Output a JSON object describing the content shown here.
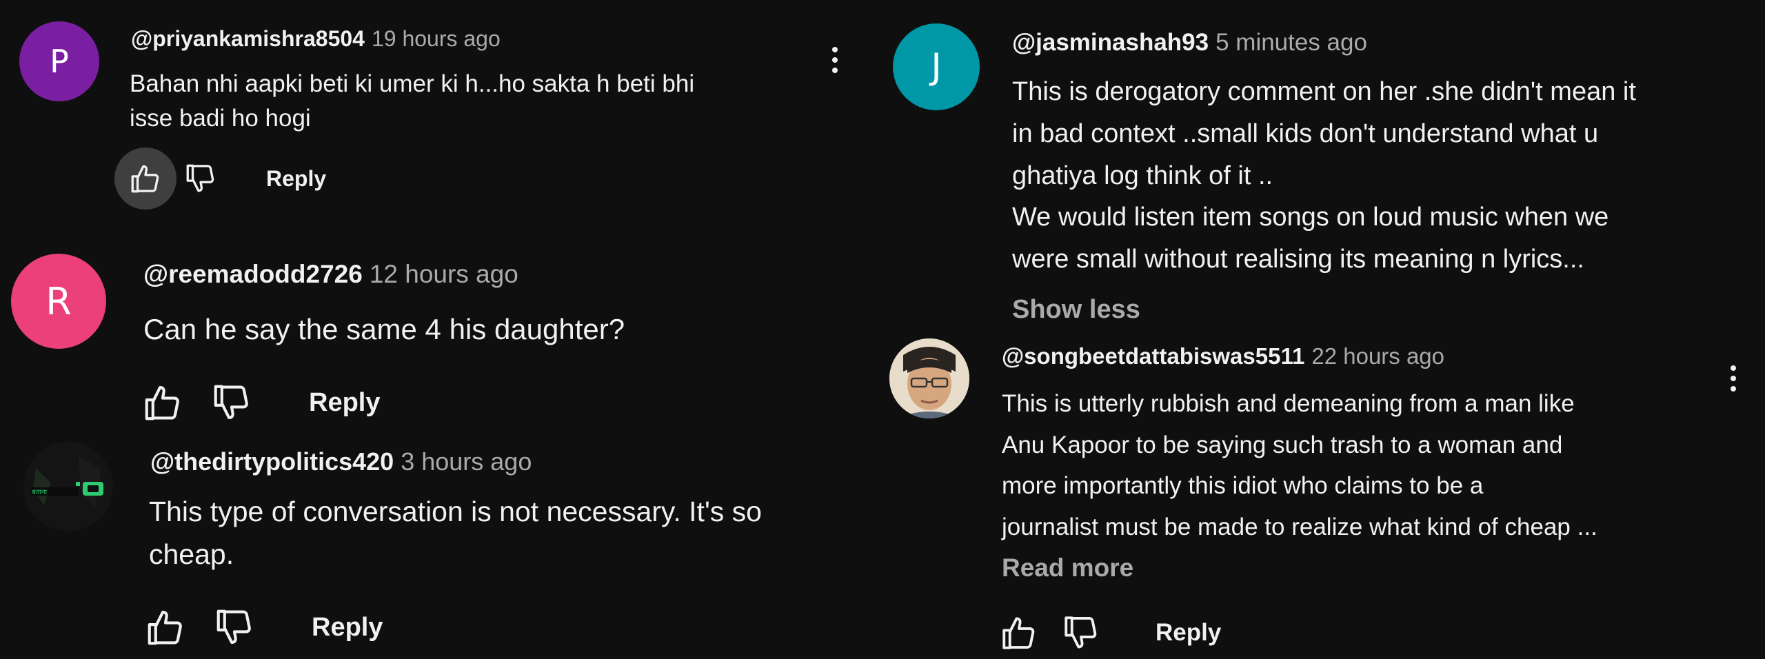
{
  "colors": {
    "background": "#0f0f0f",
    "avatar_p": "#7b1fa2",
    "avatar_r": "#ec407a",
    "avatar_j": "#0097a7",
    "like_pressed_bg": "#3f3f3f"
  },
  "comments": [
    {
      "handle": "@priyankamishra8504",
      "time": "19 hours ago",
      "avatar_letter": "P",
      "text": [
        "Bahan nhi aapki beti ki umer ki h...ho sakta h beti bhi",
        "isse badi ho hogi"
      ],
      "reply_label": "Reply"
    },
    {
      "handle": "@reemadodd2726",
      "time": "12 hours ago",
      "avatar_letter": "R",
      "text": [
        "Can he say the same 4 his daughter?"
      ],
      "reply_label": "Reply"
    },
    {
      "handle": "@thedirtypolitics420",
      "time": "3 hours ago",
      "avatar_icon": "channel-logo-icon",
      "text": [
        "This type of conversation is not necessary. It's so",
        "cheap."
      ],
      "reply_label": "Reply"
    },
    {
      "handle": "@jasminashah93",
      "time": "5 minutes ago",
      "avatar_letter": "J",
      "text": [
        "This is derogatory comment on her .she didn't mean it",
        "in bad context ..small kids don't understand what u",
        "ghatiya log think of it ..",
        "We would listen item songs on loud music when we",
        "were small without realising its meaning n lyrics..."
      ],
      "toggle_label": "Show less"
    },
    {
      "handle": "@songbeetdattabiswas5511",
      "time": "22 hours ago",
      "avatar_icon": "profile-photo-icon",
      "text": [
        "This is utterly rubbish and demeaning from a man like",
        "Anu Kapoor to be saying such trash to a woman and",
        "more importantly this idiot who claims to be a",
        "journalist must be made to realize what kind of cheap ..."
      ],
      "toggle_label": "Read more",
      "reply_label": "Reply"
    }
  ]
}
